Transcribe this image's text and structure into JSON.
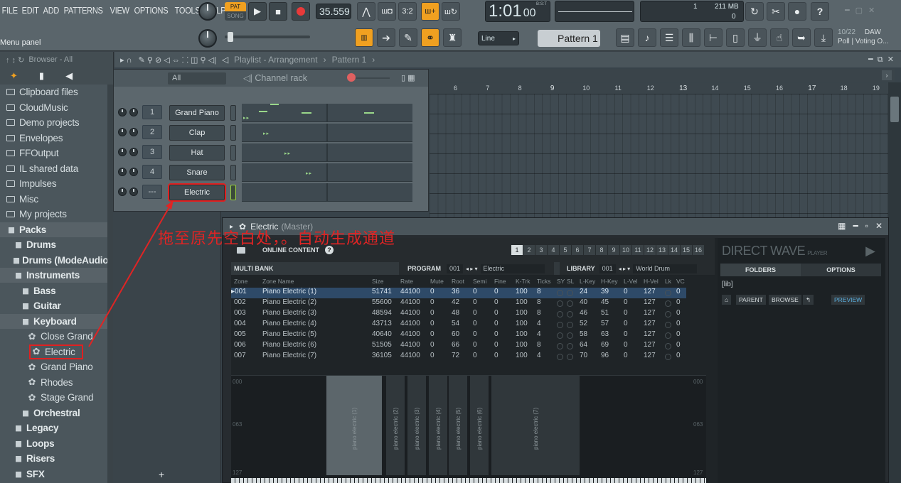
{
  "menu": [
    "FILE",
    "EDIT",
    "ADD",
    "PATTERNS",
    "VIEW",
    "OPTIONS",
    "TOOLS",
    "HELP"
  ],
  "hint_panel_label": "Menu panel",
  "transport": {
    "pat_label": "PAT",
    "song_label": "SONG",
    "tempo": "35.559",
    "time": "1:01",
    "time_sub": "00",
    "time_unit": "B:S:T"
  },
  "cpu": {
    "value": "1",
    "memory": "211 MB",
    "voices": "0"
  },
  "snap": "Line",
  "pattern_label": "Pattern 1",
  "news": {
    "date": "10/22",
    "source": "DAW",
    "text": "Poll | Voting O..."
  },
  "browser": {
    "title": "Browser - All",
    "items": [
      {
        "label": "Clipboard files",
        "kind": "folder"
      },
      {
        "label": "CloudMusic",
        "kind": "folder"
      },
      {
        "label": "Demo projects",
        "kind": "folder"
      },
      {
        "label": "Envelopes",
        "kind": "folder"
      },
      {
        "label": "FFOutput",
        "kind": "folder"
      },
      {
        "label": "IL shared data",
        "kind": "folder"
      },
      {
        "label": "Impulses",
        "kind": "folder"
      },
      {
        "label": "Misc",
        "kind": "folder"
      },
      {
        "label": "My projects",
        "kind": "folder"
      },
      {
        "label": "Packs",
        "kind": "pack"
      },
      {
        "label": "Drums",
        "kind": "pack"
      },
      {
        "label": "Drums (ModeAudio)",
        "kind": "pack"
      },
      {
        "label": "Instruments",
        "kind": "pack"
      },
      {
        "label": "Bass",
        "kind": "pack"
      },
      {
        "label": "Guitar",
        "kind": "pack"
      },
      {
        "label": "Keyboard",
        "kind": "pack"
      },
      {
        "label": "Close Grand",
        "kind": "preset"
      },
      {
        "label": "Electric",
        "kind": "preset"
      },
      {
        "label": "Grand Piano",
        "kind": "preset"
      },
      {
        "label": "Rhodes",
        "kind": "preset"
      },
      {
        "label": "Stage Grand",
        "kind": "preset"
      },
      {
        "label": "Orchestral",
        "kind": "pack"
      },
      {
        "label": "Legacy",
        "kind": "pack"
      },
      {
        "label": "Loops",
        "kind": "pack"
      },
      {
        "label": "Risers",
        "kind": "pack"
      },
      {
        "label": "SFX",
        "kind": "pack"
      }
    ]
  },
  "playlist": {
    "title": "Playlist - Arrangement",
    "pattern": "Pattern 1",
    "ruler": [
      "6",
      "7",
      "8",
      "9",
      "10",
      "11",
      "12",
      "13",
      "14",
      "15",
      "16",
      "17",
      "18",
      "19"
    ]
  },
  "channel_rack": {
    "filter": "All",
    "title": "Channel rack",
    "channels": [
      {
        "num": "1",
        "name": "Grand Piano"
      },
      {
        "num": "2",
        "name": "Clap"
      },
      {
        "num": "3",
        "name": "Hat"
      },
      {
        "num": "4",
        "name": "Snare"
      },
      {
        "num": "---",
        "name": "Electric"
      }
    ]
  },
  "plugin": {
    "title": "Electric",
    "subtitle": "(Master)",
    "online_content": "ONLINE CONTENT",
    "pages": [
      "1",
      "2",
      "3",
      "4",
      "5",
      "6",
      "7",
      "8",
      "9",
      "10",
      "11",
      "12",
      "13",
      "14",
      "15",
      "16"
    ],
    "multi_bank": "MULTI BANK",
    "program_label": "PROGRAM",
    "program_num": "001",
    "program_name": "Electric",
    "library_label": "LIBRARY",
    "library_num": "001",
    "library_name": "World Drum",
    "columns": [
      "Zone",
      "Zone Name",
      "Size",
      "Rate",
      "Mute",
      "Root",
      "Semi",
      "Fine",
      "K-Trk",
      "Ticks",
      "SY",
      "SL",
      "L-Key",
      "H-Key",
      "L-Vel",
      "H-Vel",
      "Lk",
      "VC"
    ],
    "zones": [
      {
        "zone": "001",
        "name": "Piano Electric (1)",
        "size": "51741",
        "rate": "44100",
        "mute": "0",
        "root": "36",
        "semi": "0",
        "fine": "0",
        "ktrk": "100",
        "ticks": "8",
        "lkey": "24",
        "hkey": "39",
        "lvel": "0",
        "hvel": "127",
        "vc": "0"
      },
      {
        "zone": "002",
        "name": "Piano Electric (2)",
        "size": "55600",
        "rate": "44100",
        "mute": "0",
        "root": "42",
        "semi": "0",
        "fine": "0",
        "ktrk": "100",
        "ticks": "8",
        "lkey": "40",
        "hkey": "45",
        "lvel": "0",
        "hvel": "127",
        "vc": "0"
      },
      {
        "zone": "003",
        "name": "Piano Electric (3)",
        "size": "48594",
        "rate": "44100",
        "mute": "0",
        "root": "48",
        "semi": "0",
        "fine": "0",
        "ktrk": "100",
        "ticks": "8",
        "lkey": "46",
        "hkey": "51",
        "lvel": "0",
        "hvel": "127",
        "vc": "0"
      },
      {
        "zone": "004",
        "name": "Piano Electric (4)",
        "size": "43713",
        "rate": "44100",
        "mute": "0",
        "root": "54",
        "semi": "0",
        "fine": "0",
        "ktrk": "100",
        "ticks": "4",
        "lkey": "52",
        "hkey": "57",
        "lvel": "0",
        "hvel": "127",
        "vc": "0"
      },
      {
        "zone": "005",
        "name": "Piano Electric (5)",
        "size": "40640",
        "rate": "44100",
        "mute": "0",
        "root": "60",
        "semi": "0",
        "fine": "0",
        "ktrk": "100",
        "ticks": "4",
        "lkey": "58",
        "hkey": "63",
        "lvel": "0",
        "hvel": "127",
        "vc": "0"
      },
      {
        "zone": "006",
        "name": "Piano Electric (6)",
        "size": "51505",
        "rate": "44100",
        "mute": "0",
        "root": "66",
        "semi": "0",
        "fine": "0",
        "ktrk": "100",
        "ticks": "8",
        "lkey": "64",
        "hkey": "69",
        "lvel": "0",
        "hvel": "127",
        "vc": "0"
      },
      {
        "zone": "007",
        "name": "Piano Electric (7)",
        "size": "36105",
        "rate": "44100",
        "mute": "0",
        "root": "72",
        "semi": "0",
        "fine": "0",
        "ktrk": "100",
        "ticks": "4",
        "lkey": "70",
        "hkey": "96",
        "lvel": "0",
        "hvel": "127",
        "vc": "0"
      }
    ],
    "key_labels": [
      "piano electric (1)",
      "piano electric (2)",
      "piano electric (3)",
      "piano electric (4)",
      "piano electric (5)",
      "piano electric (6)",
      "piano electric (7)"
    ],
    "scale_labels": [
      "000",
      "063",
      "127"
    ],
    "logo": "DIRECT WAVE",
    "logo_sub": "PLAYER",
    "tabs": [
      "FOLDERS",
      "OPTIONS"
    ],
    "lib_path": "[lib]",
    "nav": [
      "PARENT",
      "BROWSE",
      "PREVIEW"
    ]
  },
  "annotation": "拖至原先空白处，。自动生成通道",
  "colors": {
    "accent": "#f0a020",
    "annotation": "#e02424",
    "selection": "#2e4a68"
  }
}
